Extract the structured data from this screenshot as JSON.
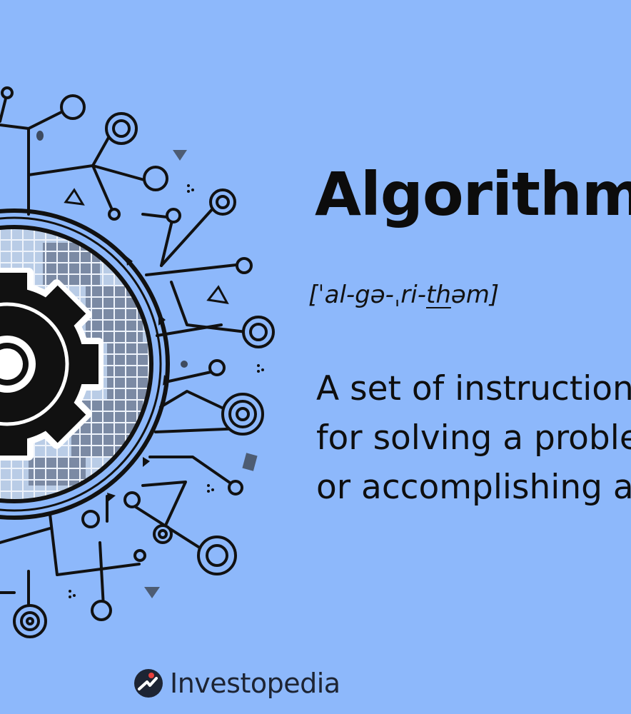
{
  "title": "Algorithm",
  "pronunciation": {
    "before": "[ˈal-gə-ˌri-",
    "underlined": "th",
    "after": "əm]"
  },
  "definition_lines": [
    "A set of instructions",
    "for solving a problem",
    "or accomplishing a"
  ],
  "brand": {
    "name": "Investopedia",
    "icon": "investopedia-logo-icon"
  },
  "colors": {
    "background": "#8db8fb",
    "ink": "#0c0c0c",
    "grid_fill": "#b9cce6",
    "grid_dark": "#7b8aa4"
  },
  "illustration": {
    "icon": "gear-circuit-icon"
  }
}
